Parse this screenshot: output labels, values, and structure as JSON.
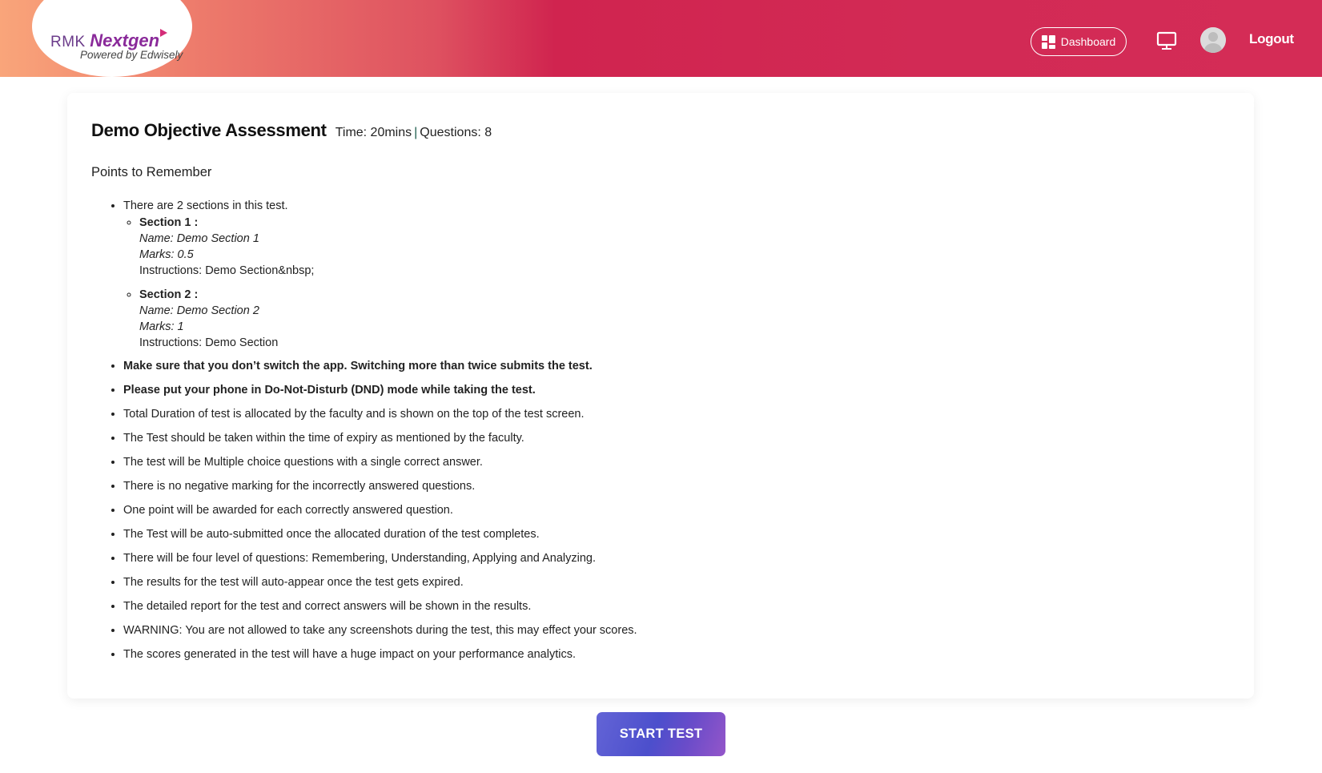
{
  "header": {
    "logo": {
      "brand_prefix": "RMK",
      "brand_name": "Nextgen",
      "tagline": "Powered by Edwisely"
    },
    "dashboard_label": "Dashboard",
    "logout_label": "Logout",
    "icons": {
      "dashboard": "grid-icon",
      "monitor": "monitor-icon",
      "avatar": "user-avatar-icon"
    }
  },
  "assessment": {
    "title": "Demo Objective Assessment",
    "time_label": "Time: 20mins",
    "separator": "|",
    "questions_label": "Questions: 8",
    "subtitle": "Points to Remember",
    "sections_intro": "There are 2 sections in this test.",
    "sections": [
      {
        "heading": "Section 1 :",
        "name": "Name: Demo Section 1",
        "marks": "Marks: 0.5",
        "instructions": "Instructions: Demo Section&nbsp;"
      },
      {
        "heading": "Section 2 :",
        "name": "Name: Demo Section 2",
        "marks": "Marks: 1",
        "instructions": "Instructions: Demo Section"
      }
    ],
    "bold_points": [
      "Make sure that you don’t switch the app. Switching more than twice submits the test.",
      "Please put your phone in Do-Not-Disturb (DND) mode while taking the test."
    ],
    "points": [
      "Total Duration of test is allocated by the faculty and is shown on the top of the test screen.",
      "The Test should be taken within the time of expiry as mentioned by the faculty.",
      "The test will be Multiple choice questions with a single correct answer.",
      "There is no negative marking for the incorrectly answered questions.",
      "One point will be awarded for each correctly answered question.",
      "The Test will be auto-submitted once the allocated duration of the test completes.",
      "There will be four level of questions: Remembering, Understanding, Applying and Analyzing.",
      "The results for the test will auto-appear once the test gets expired.",
      "The detailed report for the test and correct answers will be shown in the results.",
      "WARNING: You are not allowed to take any screenshots during the test, this may effect your scores.",
      "The scores generated in the test will have a huge impact on your performance analytics."
    ]
  },
  "start_button_label": "START TEST",
  "colors": {
    "header_accent": "#d0244f",
    "button_start": "#6364d6",
    "button_end": "#9456c9"
  }
}
